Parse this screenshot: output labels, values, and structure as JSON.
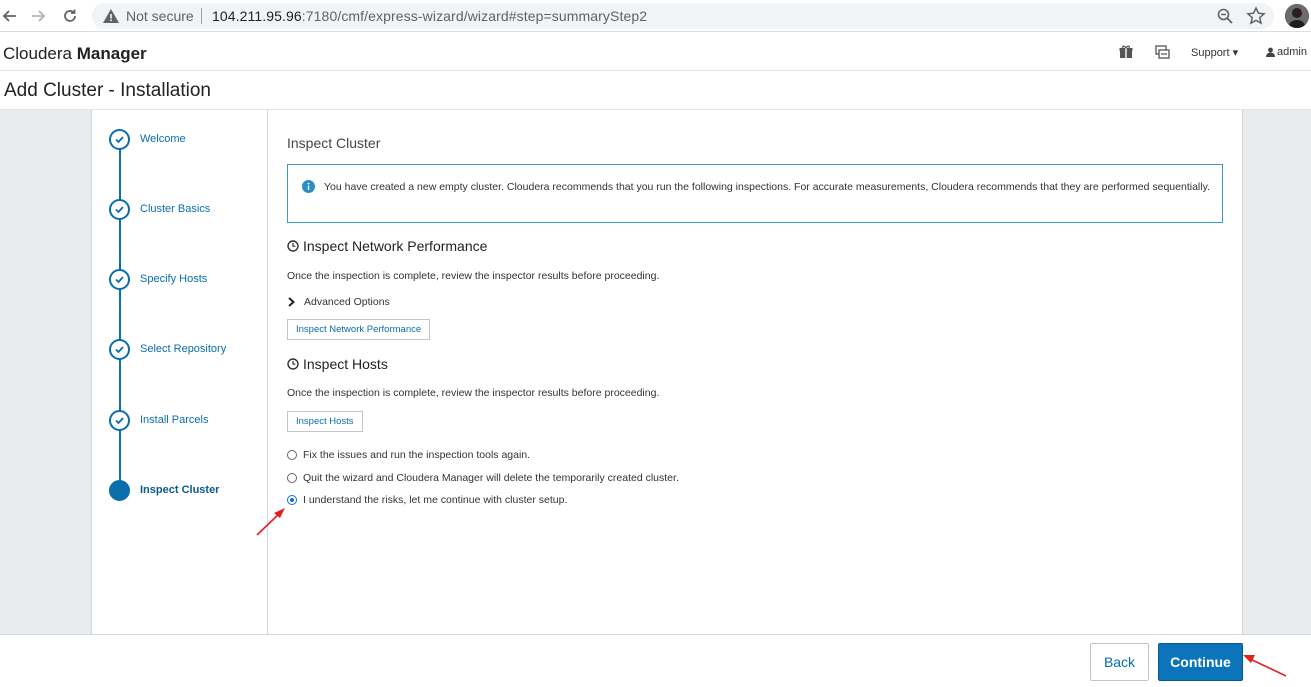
{
  "browser": {
    "security_label": "Not secure",
    "url_host": "104.211.95.96",
    "url_rest": ":7180/cmf/express-wizard/wizard#step=summaryStep2"
  },
  "header": {
    "brand_light": "Cloudera",
    "brand_bold": "Manager",
    "support_label": "Support",
    "user_label": "admin",
    "icons": [
      "gift-icon",
      "tasks-icon",
      "caret-down-icon",
      "user-icon"
    ]
  },
  "page": {
    "title": "Add Cluster - Installation"
  },
  "wizard": {
    "steps": [
      {
        "label": "Welcome",
        "status": "complete"
      },
      {
        "label": "Cluster Basics",
        "status": "complete"
      },
      {
        "label": "Specify Hosts",
        "status": "complete"
      },
      {
        "label": "Select Repository",
        "status": "complete"
      },
      {
        "label": "Install Parcels",
        "status": "complete"
      },
      {
        "label": "Inspect Cluster",
        "status": "active"
      }
    ]
  },
  "inspect": {
    "title": "Inspect Cluster",
    "info_text": "You have created a new empty cluster. Cloudera recommends that you run the following inspections. For accurate measurements, Cloudera recommends that they are performed sequentially.",
    "network": {
      "heading": "Inspect Network Performance",
      "description": "Once the inspection is complete, review the inspector results before proceeding.",
      "advanced_label": "Advanced Options",
      "button_label": "Inspect Network Performance"
    },
    "hosts": {
      "heading": "Inspect Hosts",
      "description": "Once the inspection is complete, review the inspector results before proceeding.",
      "button_label": "Inspect Hosts"
    },
    "options": [
      {
        "label": "Fix the issues and run the inspection tools again.",
        "checked": false
      },
      {
        "label": "Quit the wizard and Cloudera Manager will delete the temporarily created cluster.",
        "checked": false
      },
      {
        "label": "I understand the risks, let me continue with cluster setup.",
        "checked": true
      }
    ]
  },
  "footer": {
    "back_label": "Back",
    "continue_label": "Continue"
  },
  "colors": {
    "accent": "#0a6eab",
    "primary_button": "#0b74ba",
    "annotation_arrow": "#e02020"
  }
}
